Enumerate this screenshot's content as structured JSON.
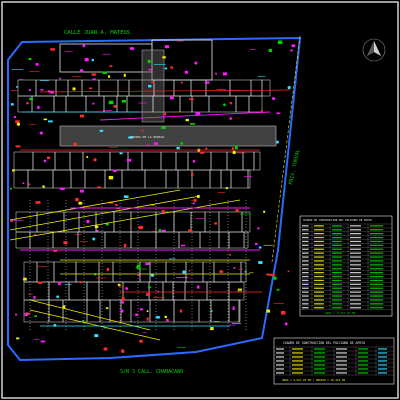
{
  "drawing": {
    "street_labels": {
      "top": "CALLE JUAN A. MATEOS",
      "bottom": "S/N 3 CALL. CHABACANO",
      "right": "PRIV. TORVAL"
    },
    "plant_label": "ARRIBA DE LA BODEGA",
    "table_top": {
      "title": "CUADRO DE CONSTRUCCION DEL POLIGONO DE APOYO",
      "footer": "AREA = 9,927.25 M2",
      "row_count": 22
    },
    "table_bottom": {
      "title": "CUADRO DE CONSTRUCCION DEL POLIGONO DE APOYO",
      "footer": "AREA = 9,927.25 M2 / PREDIO = 10,412 M2",
      "row_count": 7
    },
    "colors": {
      "background": "#000000",
      "frame": "#d0d0d0",
      "boundary": "#2a6bff",
      "green": "#00d400",
      "yellow": "#f0f000",
      "magenta": "#ff19ff",
      "red": "#ff2a2a",
      "cyan": "#33e0ff",
      "white": "#e8e8e8",
      "gray": "#8a8a8a"
    }
  }
}
